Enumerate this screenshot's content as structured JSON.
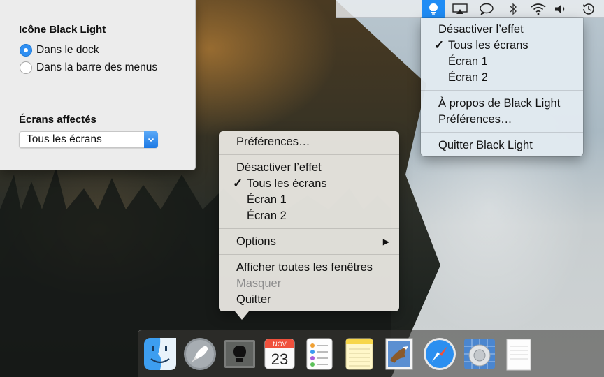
{
  "prefs_window": {
    "icon_section_title": "Icône Black Light",
    "icon_options": [
      {
        "label": "Dans le dock",
        "selected": true
      },
      {
        "label": "Dans la barre des menus",
        "selected": false
      }
    ],
    "screens_section_title": "Écrans affectés",
    "screens_select_value": "Tous les écrans"
  },
  "menubar": {
    "icons": [
      "black-light-icon",
      "airplay-icon",
      "messages-icon",
      "bluetooth-icon",
      "wifi-icon",
      "volume-icon",
      "time-machine-icon"
    ],
    "active_icon": "black-light-icon"
  },
  "status_menu": {
    "items": [
      {
        "label": "Désactiver l’effet",
        "checked": false
      },
      {
        "label": "Tous les écrans",
        "checked": true
      },
      {
        "label": "Écran 1",
        "checked": false
      },
      {
        "label": "Écran 2",
        "checked": false
      },
      {
        "label": "À propos de Black Light"
      },
      {
        "label": "Préférences…"
      },
      {
        "label": "Quitter Black Light"
      }
    ]
  },
  "dock_menu": {
    "items": [
      {
        "label": "Préférences…"
      },
      {
        "label": "Désactiver l’effet"
      },
      {
        "label": "Tous les écrans",
        "checked": true
      },
      {
        "label": "Écran 1"
      },
      {
        "label": "Écran 2"
      },
      {
        "label": "Options",
        "has_submenu": true
      },
      {
        "label": "Afficher toutes les fenêtres"
      },
      {
        "label": "Masquer",
        "disabled": true
      },
      {
        "label": "Quitter"
      }
    ],
    "check_glyph": "✓",
    "submenu_glyph": "▶"
  },
  "dock": {
    "apps": [
      {
        "name": "finder-icon",
        "running": false
      },
      {
        "name": "launchpad-icon",
        "running": false
      },
      {
        "name": "black-light-icon",
        "running": true
      },
      {
        "name": "calendar-icon",
        "running": true
      },
      {
        "name": "reminders-icon",
        "running": false
      },
      {
        "name": "notes-icon",
        "running": false
      },
      {
        "name": "mail-icon",
        "running": false
      },
      {
        "name": "safari-icon",
        "running": true
      },
      {
        "name": "photo-app-icon",
        "running": false
      },
      {
        "name": "textedit-icon",
        "running": false
      }
    ],
    "calendar_month": "NOV",
    "calendar_day": "23"
  },
  "colors": {
    "accent": "#1f8cf5",
    "menu_text": "#111111",
    "disabled_text": "#8d8d8d"
  }
}
